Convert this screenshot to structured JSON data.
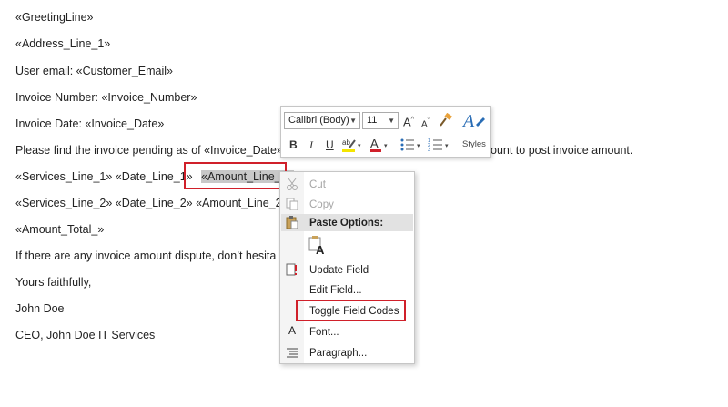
{
  "document": {
    "lines": [
      "«GreetingLine»",
      "«Address_Line_1»",
      "User email: «Customer_Email»",
      "Invoice Number: «Invoice_Number»",
      "Invoice Date: «Invoice_Date»",
      "Please find the invoice pending as of «Invoice_Date»",
      "ount to post invoice amount.",
      "«Services_Line_1» «Date_Line_1»",
      "«Amount_Line_1»",
      "«Services_Line_2» «Date_Line_2» «Amount_Line_2»",
      "«Amount_Total_»",
      "If there are any invoice amount dispute, don’t hesita",
      "Yours faithfully,",
      "John Doe",
      "CEO, John Doe IT Services"
    ]
  },
  "mini_toolbar": {
    "font_name": "Calibri (Body)",
    "font_size": "11",
    "grow_font": "A",
    "shrink_font": "A",
    "bold": "B",
    "italic": "I",
    "underline": "U",
    "font_color_letter": "A",
    "styles_label": "Styles",
    "highlight_color": "#f4e500",
    "font_color": "#d0202a"
  },
  "context_menu": {
    "cut": "Cut",
    "copy": "Copy",
    "paste_options": "Paste Options:",
    "paste_keep_text": "A",
    "update_field": "Update Field",
    "edit_field": "Edit Field...",
    "toggle_field_codes": "Toggle Field Codes",
    "font": "Font...",
    "font_icon": "A",
    "paragraph": "Paragraph..."
  },
  "colors": {
    "highlight_box": "#d0202a",
    "selection": "#c8c8c8"
  }
}
